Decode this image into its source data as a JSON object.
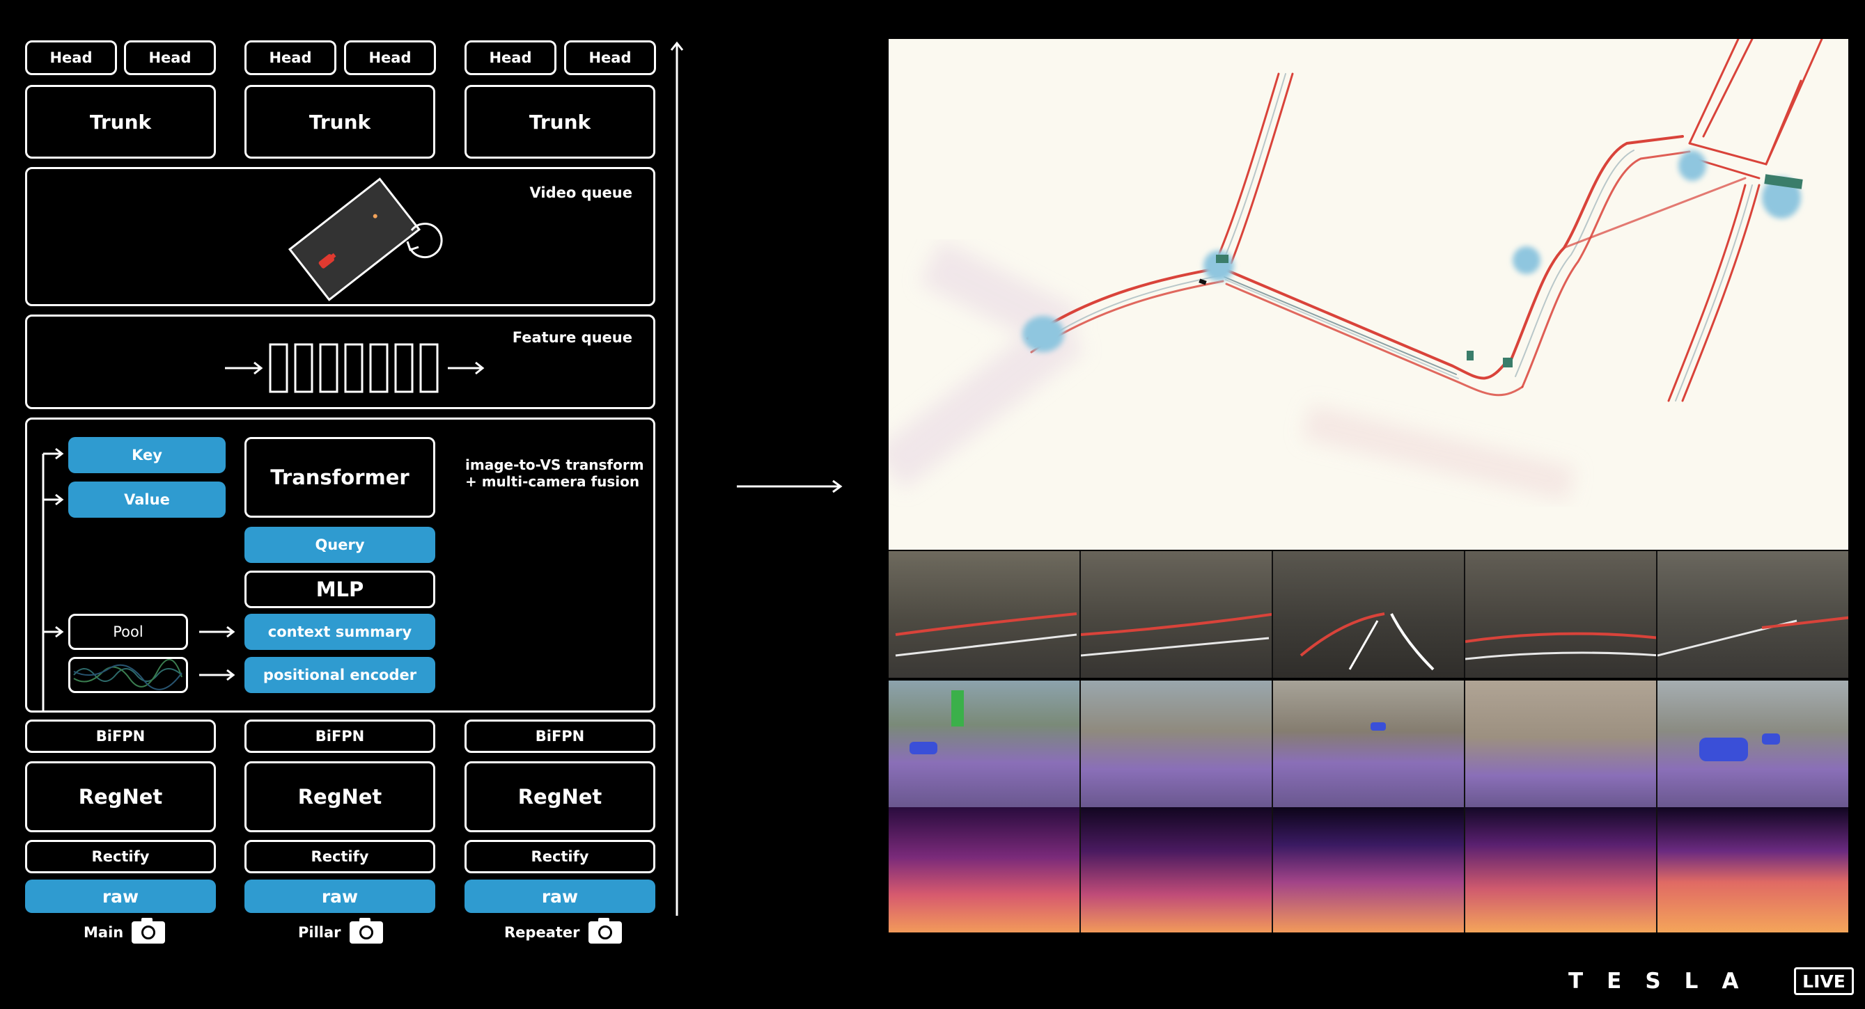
{
  "diagram": {
    "heads": [
      "Head",
      "Head",
      "Head",
      "Head",
      "Head",
      "Head"
    ],
    "trunks": [
      "Trunk",
      "Trunk",
      "Trunk"
    ],
    "video_queue": "Video queue",
    "feature_queue": "Feature queue",
    "fusion": {
      "key": "Key",
      "value": "Value",
      "transformer": "Transformer",
      "query": "Query",
      "mlp": "MLP",
      "pool": "Pool",
      "context_summary": "context summary",
      "positional_encoder": "positional encoder",
      "description": "image-to-VS transform\n+ multi-camera fusion"
    },
    "bifpn": [
      "BiFPN",
      "BiFPN",
      "BiFPN"
    ],
    "regnet": [
      "RegNet",
      "RegNet",
      "RegNet"
    ],
    "rectify": [
      "Rectify",
      "Rectify",
      "Rectify"
    ],
    "raw": [
      "raw",
      "raw",
      "raw"
    ],
    "cameras": [
      "Main",
      "Pillar",
      "Repeater"
    ]
  },
  "colors": {
    "accent_blue": "#2f9bd0",
    "map_background": "#fbf9f0",
    "lane_red": "#d9433a",
    "intersection_blue": "#8fc6df",
    "segmentation_purple": "#8a6fb8",
    "depth_orange": "#f29a5a"
  },
  "branding": {
    "logo_letters": [
      "T",
      "E",
      "S",
      "L",
      "A"
    ],
    "live_badge": "LIVE"
  }
}
